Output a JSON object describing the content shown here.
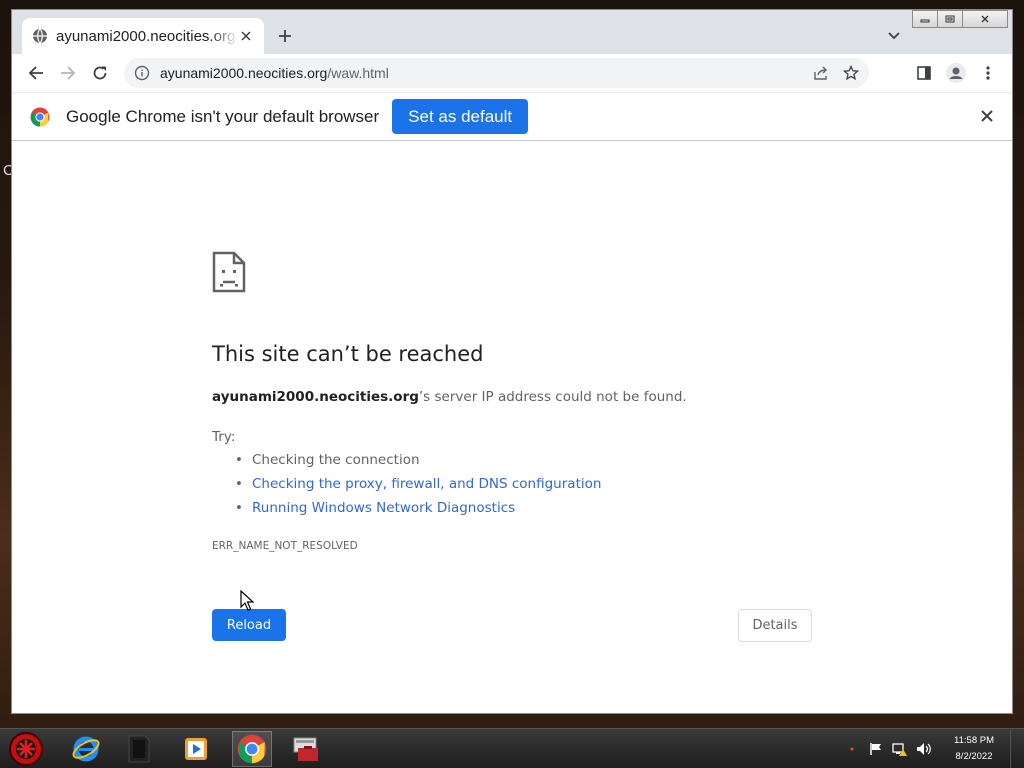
{
  "desktop": {
    "edge_glyph": "C"
  },
  "tab": {
    "title": "ayunami2000.neocities.org",
    "favicon": "globe-icon"
  },
  "window_controls": {
    "icons": [
      "minimize-icon",
      "restore-icon",
      "close-icon"
    ]
  },
  "toolbar": {
    "url_host": "ayunami2000.neocities.org",
    "url_path": "/waw.html",
    "icons": [
      "back-icon",
      "forward-icon",
      "reload-icon",
      "site-info-icon",
      "share-icon",
      "star-icon",
      "side-panel-icon",
      "profile-icon",
      "menu-icon"
    ]
  },
  "infobar": {
    "message": "Google Chrome isn't your default browser",
    "button_label": "Set as default"
  },
  "error": {
    "title": "This site can’t be reached",
    "host": "ayunami2000.neocities.org",
    "description_suffix": "’s server IP address could not be found.",
    "try_label": "Try:",
    "suggestions": [
      "Checking the connection",
      "Checking the proxy, firewall, and DNS configuration",
      "Running Windows Network Diagnostics"
    ],
    "code": "ERR_NAME_NOT_RESOLVED",
    "reload_label": "Reload",
    "details_label": "Details"
  },
  "taskbar": {
    "apps": [
      "start-orb",
      "internet-explorer",
      "app-dark-tile",
      "media-player",
      "google-chrome",
      "toolbox-app"
    ],
    "time": "11:58 PM",
    "date": "8/2/2022"
  },
  "colors": {
    "accent": "#1a73e8",
    "link": "#3367d6",
    "text": "#202124",
    "muted": "#5f6368"
  }
}
